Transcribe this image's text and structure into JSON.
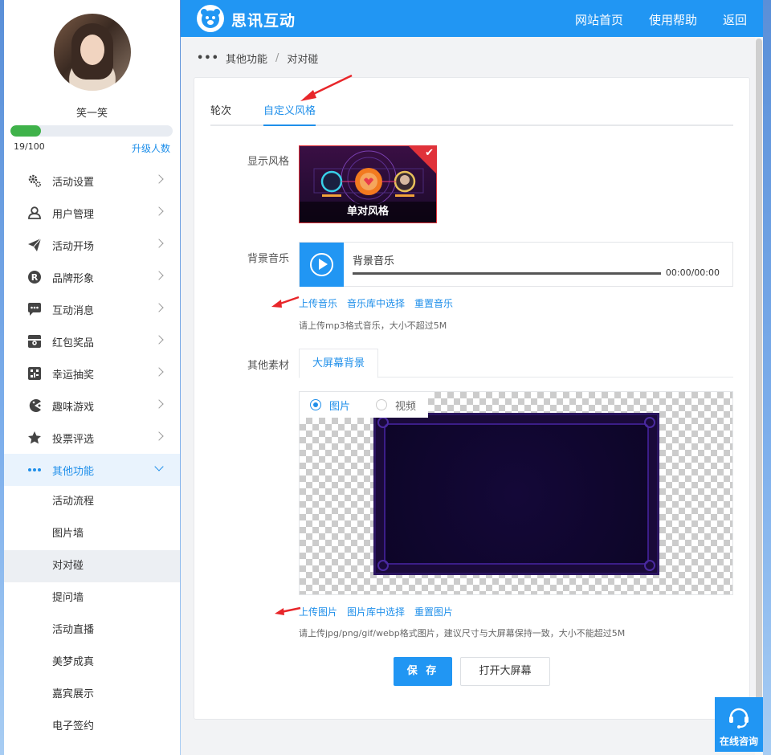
{
  "sidebar": {
    "username": "笑一笑",
    "quota": {
      "used_text": "19/100",
      "fraction": 0.19,
      "upgrade_label": "升级人数"
    },
    "menu": [
      {
        "label": "活动设置",
        "icon": "gear-icon"
      },
      {
        "label": "用户管理",
        "icon": "user-icon"
      },
      {
        "label": "活动开场",
        "icon": "paper-plane-icon"
      },
      {
        "label": "品牌形象",
        "icon": "registered-icon"
      },
      {
        "label": "互动消息",
        "icon": "chat-icon"
      },
      {
        "label": "红包奖品",
        "icon": "gift-icon"
      },
      {
        "label": "幸运抽奖",
        "icon": "lottery-icon"
      },
      {
        "label": "趣味游戏",
        "icon": "game-icon"
      },
      {
        "label": "投票评选",
        "icon": "star-icon"
      },
      {
        "label": "其他功能",
        "icon": "more-dots-icon"
      }
    ],
    "submenu": [
      "活动流程",
      "图片墙",
      "对对碰",
      "提问墙",
      "活动直播",
      "美梦成真",
      "嘉宾展示",
      "电子签约"
    ]
  },
  "header": {
    "brand": "思讯互动",
    "nav": [
      "网站首页",
      "使用帮助",
      "返回"
    ]
  },
  "breadcrumb": {
    "parent": "其他功能",
    "sep": "/",
    "current": "对对碰"
  },
  "tabs": [
    "轮次",
    "自定义风格"
  ],
  "display_style": {
    "label": "显示风格",
    "card_label": "单对风格"
  },
  "music": {
    "label": "背景音乐",
    "title": "背景音乐",
    "time": "00:00/00:00",
    "links": [
      "上传音乐",
      "音乐库中选择",
      "重置音乐"
    ],
    "hint": "请上传mp3格式音乐，大小不超过5M"
  },
  "material": {
    "label": "其他素材",
    "subtab": "大屏幕背景",
    "radio_image": "图片",
    "radio_video": "视频",
    "links": [
      "上传图片",
      "图片库中选择",
      "重置图片"
    ],
    "hint": "请上传jpg/png/gif/webp格式图片，建议尺寸与大屏幕保持一致，大小不能超过5M"
  },
  "actions": {
    "save": "保 存",
    "open_screen": "打开大屏幕"
  },
  "consult": "在线咨询",
  "colors": {
    "primary": "#2196f3",
    "link": "#1f8fea",
    "progress": "#3fb24a",
    "arrow": "#e8262a"
  }
}
